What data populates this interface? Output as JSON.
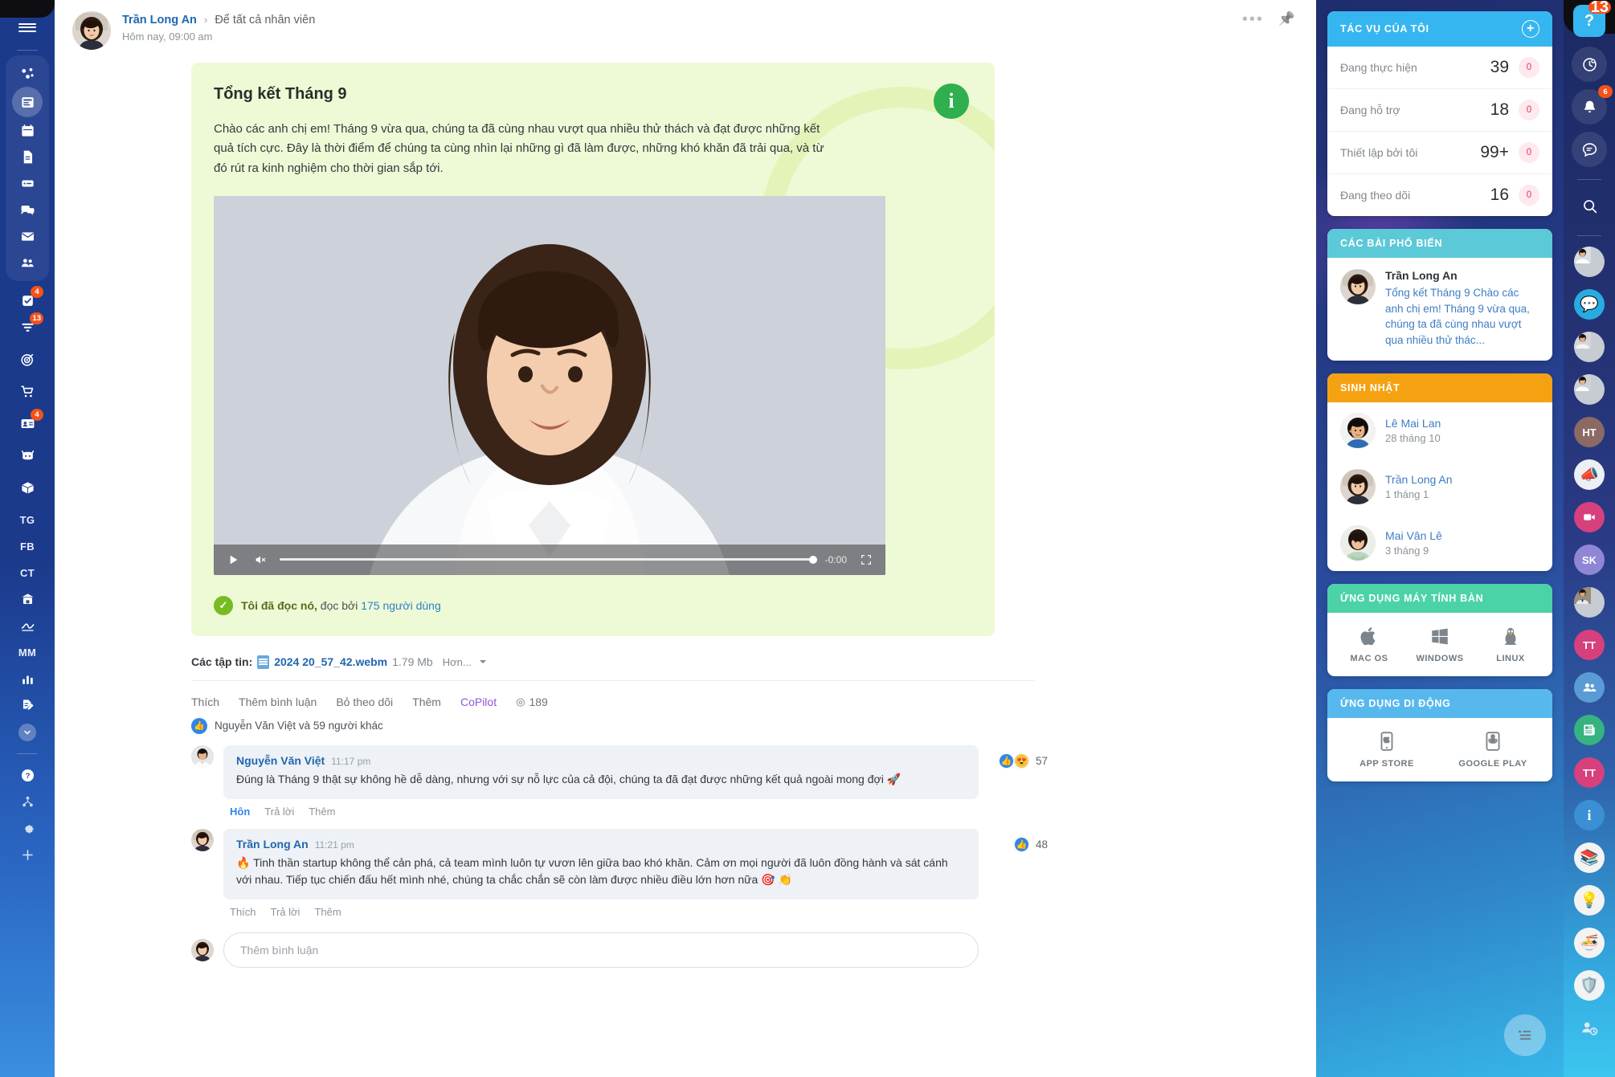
{
  "left_sidebar": {
    "burger": "menu-icon",
    "items": [
      {
        "name": "activity-stream-icon",
        "badge": null
      },
      {
        "name": "feed-icon",
        "badge": null,
        "active": true
      },
      {
        "name": "calendar-icon",
        "badge": null
      },
      {
        "name": "documents-icon",
        "badge": null
      },
      {
        "name": "drive-icon",
        "badge": null
      },
      {
        "name": "chat-icon",
        "badge": null
      },
      {
        "name": "mail-icon",
        "badge": null
      },
      {
        "name": "contacts-icon",
        "badge": null
      }
    ],
    "items2": [
      {
        "name": "tasks-icon",
        "badge": "4"
      },
      {
        "name": "funnel-icon",
        "badge": "13"
      },
      {
        "name": "crm-target-icon",
        "badge": null
      },
      {
        "name": "shop-cart-icon",
        "badge": null
      },
      {
        "name": "id-card-icon",
        "badge": "4"
      },
      {
        "name": "bot-icon",
        "badge": null
      },
      {
        "name": "inventory-box-icon",
        "badge": null
      }
    ],
    "text_items": [
      {
        "label": "TG"
      },
      {
        "label": "FB"
      },
      {
        "label": "CT"
      }
    ],
    "items3": [
      {
        "name": "company-icon",
        "badge": null
      },
      {
        "name": "signature-icon",
        "badge": null
      }
    ],
    "text_items2": [
      {
        "label": "MM"
      }
    ],
    "items4": [
      {
        "name": "analytics-icon",
        "badge": null
      },
      {
        "name": "edit-doc-icon",
        "badge": null
      },
      {
        "name": "chevron-down-icon",
        "badge": null
      }
    ],
    "footer_items": [
      {
        "name": "help-icon"
      },
      {
        "name": "sitemap-icon"
      },
      {
        "name": "settings-gear-icon"
      },
      {
        "name": "add-plus-icon"
      }
    ]
  },
  "post": {
    "author": "Trần Long An",
    "separator": "›",
    "recipient": "Để tất cả nhân viên",
    "timestamp": "Hôm nay, 09:00 am",
    "more_icon": "more-options-icon",
    "pin_icon": "pin-icon",
    "info_badge": "i",
    "title": "Tổng kết Tháng 9",
    "body": "Chào các anh chị em! Tháng 9 vừa qua, chúng ta đã cùng nhau vượt qua nhiều thử thách và đạt được những kết quả tích cực. Đây là thời điểm để chúng ta cùng nhìn lại những gì đã làm được, những khó khăn đã trải qua, và từ đó rút ra kinh nghiệm cho thời gian sắp tới.",
    "video": {
      "play_icon": "play-icon",
      "mute_icon": "volume-muted-icon",
      "time": "-0:00",
      "fullscreen_icon": "fullscreen-icon"
    },
    "read": {
      "check_icon": "check-circle-icon",
      "i_read_it": "Tôi đã đọc nó,",
      "read_by": "đọc bởi",
      "count_link": "175 người dùng"
    },
    "files": {
      "label": "Các tập tin:",
      "file_icon": "video-file-icon",
      "filename": "2024 20_57_42.webm",
      "size": "1.79 Mb",
      "more": "Hơn..."
    },
    "actions": {
      "like": "Thích",
      "comment": "Thêm bình luận",
      "unfollow": "Bỏ theo dõi",
      "more": "Thêm",
      "copilot": "CoPilot",
      "views_icon": "eye-icon",
      "views": "189"
    },
    "likes": {
      "icon": "thumbs-up-icon",
      "text": "Nguyễn Văn Việt và 59 người khác"
    }
  },
  "comments": [
    {
      "author": "Nguyễn Văn Việt",
      "time": "11:17 pm",
      "text": "Đúng là Tháng 9 thật sự không hề dễ dàng, nhưng với sự nỗ lực của cả đội, chúng ta đã đạt được những kết quả ngoài mong đợi 🚀",
      "reactions": [
        "👍",
        "😍"
      ],
      "reaction_count": "57",
      "actions": {
        "like": "Hôn",
        "reply": "Trả lời",
        "more": "Thêm"
      },
      "like_active": true
    },
    {
      "author": "Trần Long An",
      "time": "11:21 pm",
      "text": "🔥 Tinh thần startup không thể cản phá, cả team mình luôn tự vươn lên giữa bao khó khăn. Cảm ơn mọi người đã luôn đồng hành và sát cánh với nhau. Tiếp tục chiến đấu hết mình nhé, chúng ta chắc chắn sẽ còn làm được nhiều điều lớn hơn nữa 🎯 👏",
      "reactions": [
        "👍"
      ],
      "reaction_count": "48",
      "actions": {
        "like": "Thích",
        "reply": "Trả lời",
        "more": "Thêm"
      },
      "like_active": false
    }
  ],
  "comment_box": {
    "placeholder": "Thêm bình luận"
  },
  "right_panel": {
    "tasks": {
      "title": "TÁC VỤ CỦA TÔI",
      "add_icon": "plus-circle-icon",
      "rows": [
        {
          "label": "Đang thực hiện",
          "count": "39",
          "zero": "0"
        },
        {
          "label": "Đang hỗ trợ",
          "count": "18",
          "zero": "0"
        },
        {
          "label": "Thiết lập bởi tôi",
          "count": "99+",
          "zero": "0"
        },
        {
          "label": "Đang theo dõi",
          "count": "16",
          "zero": "0"
        }
      ]
    },
    "popular": {
      "title": "CÁC BÀI PHỔ BIẾN",
      "author": "Trần Long An",
      "excerpt": "Tổng kết Tháng 9 Chào các anh chị em! Tháng 9 vừa qua, chúng ta đã cùng nhau vượt qua nhiều thử thác..."
    },
    "birthdays": {
      "title": "SINH NHẬT",
      "rows": [
        {
          "name": "Lê Mai Lan",
          "date": "28 tháng 10"
        },
        {
          "name": "Trần Long An",
          "date": "1 tháng 1"
        },
        {
          "name": "Mai Vân Lê",
          "date": "3 tháng 9"
        }
      ]
    },
    "desktop_apps": {
      "title": "ỨNG DỤNG MÁY TÍNH BÀN",
      "items": [
        {
          "label": "MAC OS",
          "icon": "apple-icon"
        },
        {
          "label": "WINDOWS",
          "icon": "windows-icon"
        },
        {
          "label": "LINUX",
          "icon": "linux-penguin-icon"
        }
      ]
    },
    "mobile_apps": {
      "title": "ỨNG DỤNG DI ĐỘNG",
      "items": [
        {
          "label": "APP STORE",
          "icon": "iphone-apple-icon"
        },
        {
          "label": "GOOGLE PLAY",
          "icon": "android-phone-icon"
        }
      ]
    },
    "fab_icon": "list-menu-icon"
  },
  "right_rail": {
    "help": {
      "label": "?",
      "badge": "13",
      "icon": "help-icon"
    },
    "top_items": [
      {
        "name": "pulse-time-icon",
        "badge": null
      },
      {
        "name": "bell-notification-icon",
        "badge": "6"
      },
      {
        "name": "chat-bubble-icon",
        "badge": null
      }
    ],
    "search_icon": "search-icon",
    "contacts": [
      {
        "type": "photo",
        "name": "avatar-male-1"
      },
      {
        "type": "emoji",
        "glyph": "💬",
        "name": "chat-group-avatar",
        "bg": "#29abe2"
      },
      {
        "type": "photo",
        "name": "avatar-male-2"
      },
      {
        "type": "photo",
        "name": "avatar-male-3"
      },
      {
        "type": "initials",
        "label": "HT",
        "bg": "#8a6a63",
        "name": "avatar-initials-ht"
      },
      {
        "type": "emoji",
        "glyph": "📣",
        "name": "announcement-avatar",
        "bg": "#f2f2f2"
      },
      {
        "type": "icon",
        "glyph": "video",
        "bg": "#d6407c",
        "name": "video-call-avatar"
      },
      {
        "type": "initials",
        "label": "SK",
        "bg": "#8f86d6",
        "name": "avatar-initials-sk"
      },
      {
        "type": "photo",
        "name": "avatar-male-4"
      },
      {
        "type": "initials",
        "label": "TT",
        "bg": "#d6407c",
        "name": "avatar-initials-tt"
      },
      {
        "type": "icon",
        "glyph": "people",
        "bg": "#5b9bd5",
        "name": "group-avatar"
      },
      {
        "type": "icon",
        "glyph": "news",
        "bg": "#36b37e",
        "name": "news-avatar"
      },
      {
        "type": "initials",
        "label": "TT",
        "bg": "#d6407c",
        "name": "avatar-initials-tt-2"
      },
      {
        "type": "icon",
        "glyph": "info",
        "bg": "#3b8fd4",
        "name": "info-avatar"
      },
      {
        "type": "emoji",
        "glyph": "📚",
        "name": "book-club-avatar",
        "bg": "#f3f3f3"
      },
      {
        "type": "emoji",
        "glyph": "💡",
        "name": "idea-avatar",
        "bg": "#f3f3f3"
      },
      {
        "type": "emoji",
        "glyph": "🍜",
        "name": "food-avatar",
        "bg": "#f3f3f3"
      },
      {
        "type": "emoji",
        "glyph": "🛡️",
        "name": "security-avatar",
        "bg": "#f3f3f3"
      },
      {
        "type": "icon",
        "glyph": "usertime",
        "bg": "transparent",
        "name": "time-tracking-icon"
      }
    ]
  }
}
